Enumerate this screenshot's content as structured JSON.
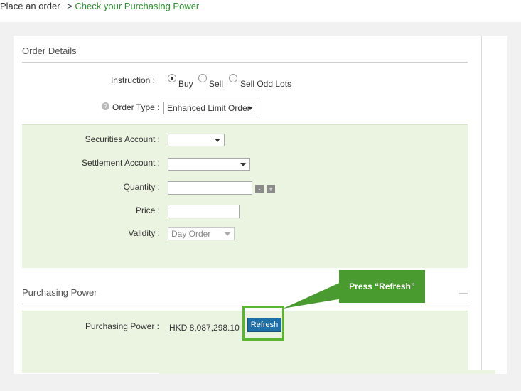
{
  "breadcrumb": {
    "parent": "Place an order",
    "separator": ">",
    "current": "Check your Purchasing Power"
  },
  "order_details": {
    "title": "Order Details",
    "instruction_label": "Instruction :",
    "instruction_options": [
      "Buy",
      "Sell",
      "Sell Odd Lots"
    ],
    "instruction_selected": "Buy",
    "order_type_label": "Order Type :",
    "order_type_value": "Enhanced Limit Order",
    "help_icon": "question-icon",
    "securities_account_label": "Securities Account :",
    "securities_account_value": "",
    "settlement_account_label": "Settlement Account :",
    "settlement_account_value": "",
    "quantity_label": "Quantity :",
    "quantity_value": "",
    "quantity_minus": "-",
    "quantity_plus": "+",
    "price_label": "Price :",
    "price_value": "",
    "validity_label": "Validity :",
    "validity_value": "Day Order"
  },
  "purchasing_power": {
    "title": "Purchasing Power",
    "label": "Purchasing Power :",
    "value": "HKD 8,087,298.10",
    "refresh_label": "Refresh"
  },
  "callout": {
    "text": "Press “Refresh”",
    "color": "#4a9b2f"
  },
  "colors": {
    "accent_green": "#2f8f2f",
    "panel_green": "#eaf4e1",
    "button_blue": "#1e6ea8",
    "highlight_green": "#5cb531"
  }
}
